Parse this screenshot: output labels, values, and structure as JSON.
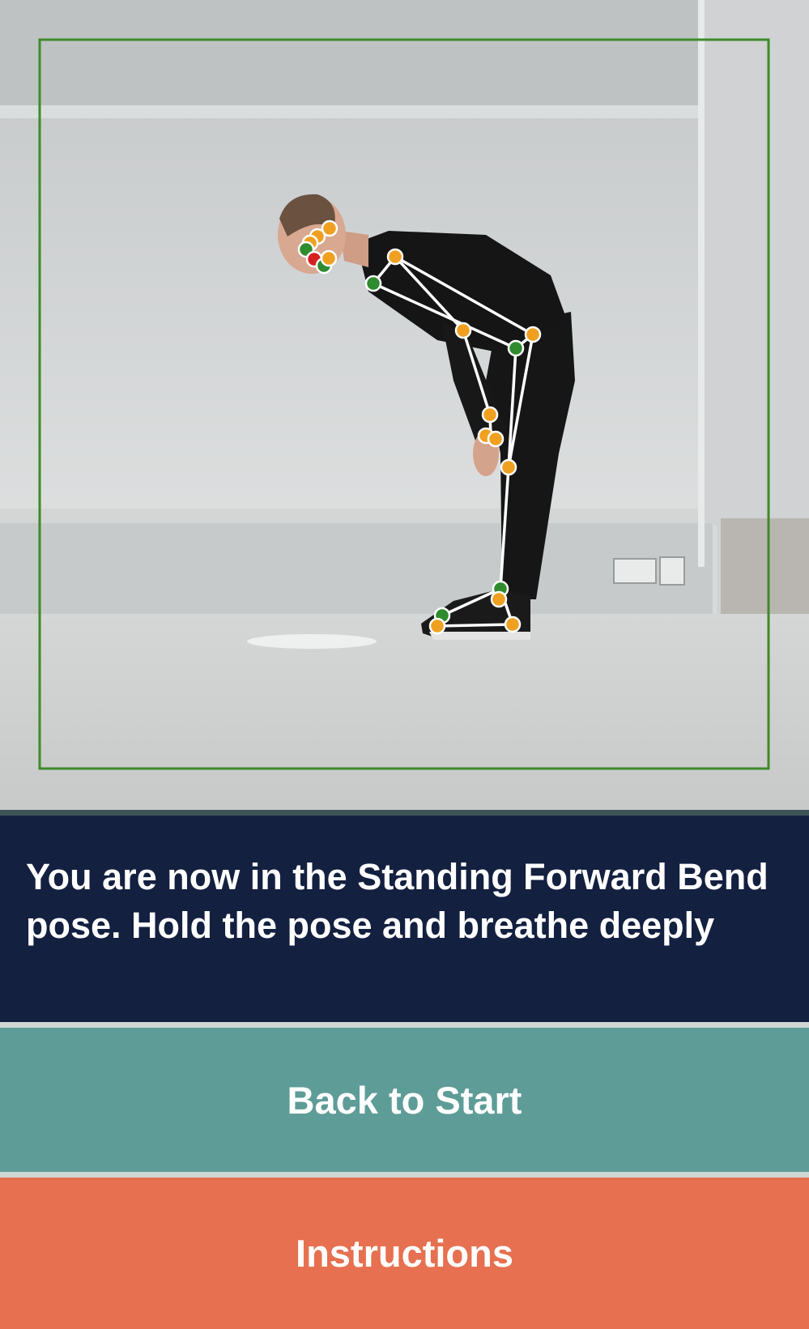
{
  "camera": {
    "detection_box_color": "#3d8a2a",
    "skeleton_line_color": "#ffffff",
    "keypoint_colors": {
      "confident": "#f0a020",
      "good": "#2e8b2e",
      "low": "#d62020"
    }
  },
  "status": {
    "message": "You are now in the Standing Forward Bend pose. Hold the pose and breathe deeply"
  },
  "actions": {
    "back_to_start_label": "Back to Start",
    "instructions_label": "Instructions"
  },
  "colors": {
    "status_background": "#142040",
    "back_button": "#5e9c97",
    "instructions_button": "#e6704f"
  }
}
